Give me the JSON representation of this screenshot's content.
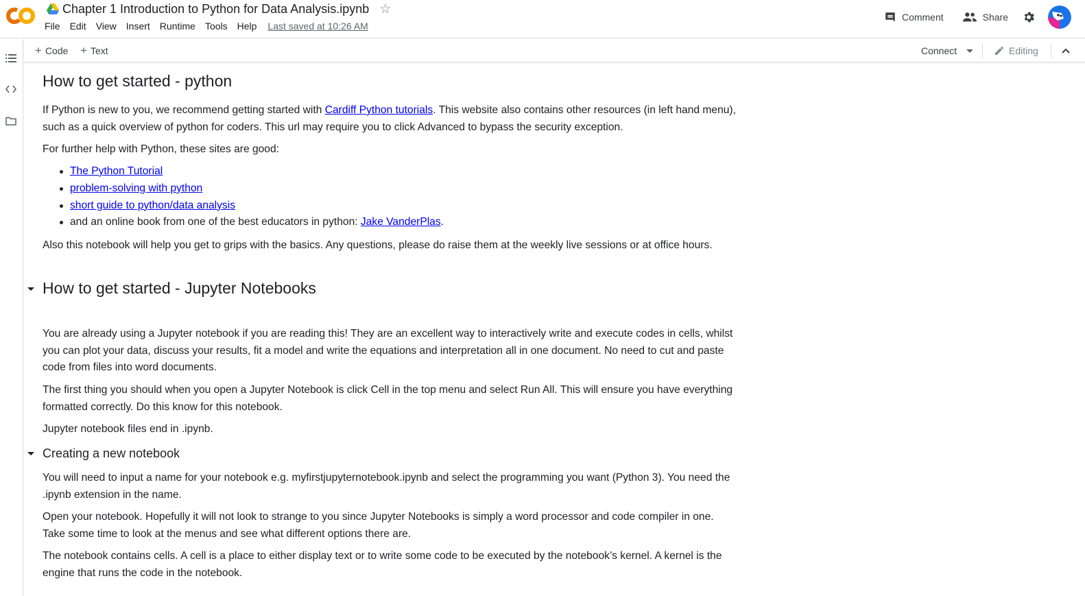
{
  "header": {
    "title": "Chapter 1 Introduction to Python for Data Analysis.ipynb",
    "menu": [
      "File",
      "Edit",
      "View",
      "Insert",
      "Runtime",
      "Tools",
      "Help"
    ],
    "last_saved": "Last saved at 10:26 AM",
    "comment_label": "Comment",
    "share_label": "Share"
  },
  "toolbar": {
    "code_label": "Code",
    "text_label": "Text",
    "connect_label": "Connect",
    "editing_label": "Editing"
  },
  "notebook": {
    "s1_heading": "How to get started - python",
    "s1_p1": {
      "pre": "If Python is new to you, we recommend getting started with ",
      "link": "Cardiff Python tutorials",
      "post": ". This website also contains other resources (in left hand menu), such as a quick overview of python for coders. This url may require you to click Advanced to bypass the security exception."
    },
    "s1_p2": "For further help with Python, these sites are good:",
    "s1_links": [
      "The Python Tutorial",
      "problem-solving with python",
      "short guide to python/data analysis"
    ],
    "s1_last_item": {
      "pre": "and an online book from one of the best educators in python: ",
      "link": "Jake VanderPlas",
      "post": "."
    },
    "s1_p3": "Also this notebook will help you get to grips with the basics. Any questions, please do raise them at the weekly live sessions or at office hours.",
    "s2_heading": "How to get started - Jupyter Notebooks",
    "s2_p1": "You are already using a Jupyter notebook if you are reading this! They are an excellent way to interactively write and execute codes in cells, whilst you can plot your data, discuss your results, fit a model and write the equations and interpretation all in one document. No need to cut and paste code from files into word documents.",
    "s2_p2": "The first thing you should when you open a Jupyter Notebook is click Cell in the top menu and select Run All. This will ensure you have everything formatted correctly. Do this know for this notebook.",
    "s2_p3": "Jupyter notebook files end in .ipynb.",
    "s3_heading": "Creating a new notebook",
    "s3_p1": "You will need to input a name for your notebook e.g. myfirstjupyternotebook.ipynb and select the programming you want (Python 3). You need the .ipynb extension in the name.",
    "s3_p2": "Open your notebook. Hopefully it will not look to strange to you since Jupyter Notebooks is simply a word processor and code compiler in one. Take some time to look at the menus and see what different options there are.",
    "s3_p3": "The notebook contains cells. A cell is a place to either display text or to write some code to be executed by the notebook’s kernel. A kernel is the engine that runs the code in the notebook."
  },
  "colors": {
    "link": "#0000ee",
    "logo_orange": "#f9ab00",
    "logo_dark_orange": "#e8710a",
    "border": "#dadce0",
    "avatar_blue": "#1a73e8"
  },
  "icons": [
    "colab-logo",
    "drive-icon",
    "star-icon",
    "comment-icon",
    "share-people-icon",
    "gear-icon",
    "avatar",
    "toc-icon",
    "code-snippets-icon",
    "folder-icon",
    "pencil-icon",
    "chevron-up-icon",
    "collapse-triangle-icon"
  ]
}
